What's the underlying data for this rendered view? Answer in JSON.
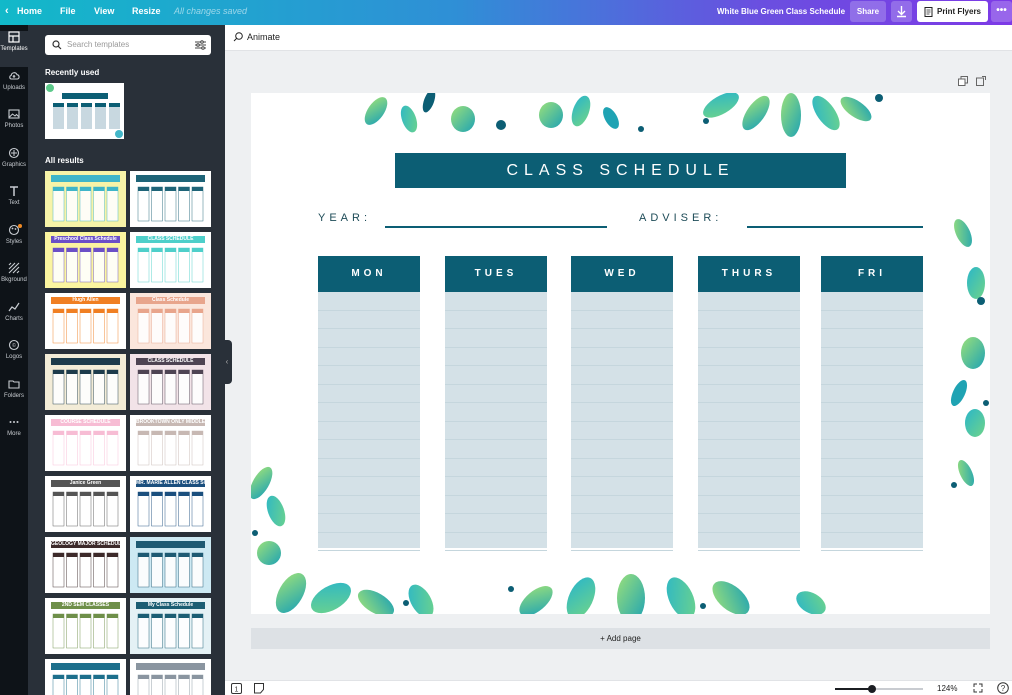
{
  "topbar": {
    "back_icon": "chevron-left-icon",
    "home": "Home",
    "file": "File",
    "view": "View",
    "resize": "Resize",
    "saved_status": "All changes saved",
    "doc_name": "White Blue Green Class Schedule",
    "share": "Share",
    "download_icon": "download-icon",
    "print": "Print Flyers",
    "print_icon": "document-icon",
    "more": "•••"
  },
  "rail": {
    "items": [
      {
        "label": "Templates",
        "icon": "layout-icon",
        "active": true
      },
      {
        "label": "Uploads",
        "icon": "cloud-upload-icon"
      },
      {
        "label": "Photos",
        "icon": "image-icon"
      },
      {
        "label": "Graphics",
        "icon": "shapes-icon"
      },
      {
        "label": "Text",
        "icon": "text-icon"
      },
      {
        "label": "Styles",
        "icon": "palette-icon"
      },
      {
        "label": "Bkground",
        "icon": "pattern-icon"
      },
      {
        "label": "Charts",
        "icon": "chart-icon"
      },
      {
        "label": "Logos",
        "icon": "logo-icon"
      },
      {
        "label": "Folders",
        "icon": "folder-icon"
      },
      {
        "label": "More",
        "icon": "more-icon"
      }
    ]
  },
  "panel": {
    "search_placeholder": "Search templates",
    "recently_used": "Recently used",
    "all_results": "All results",
    "thumbnails": [
      {
        "title": "",
        "color": "#f7f3a8",
        "accent": "#3fb5c9"
      },
      {
        "title": "",
        "color": "#ffffff",
        "accent": "#1e6478"
      },
      {
        "title": "Preschool Class Schedule",
        "color": "#fbf5a0",
        "accent": "#6b4fc7"
      },
      {
        "title": "CLASS SCHEDULE",
        "color": "#ffffff",
        "accent": "#4ecfca"
      },
      {
        "title": "Hugh Allen",
        "color": "#ffffff",
        "accent": "#f07f23"
      },
      {
        "title": "Class Schedule",
        "color": "#fbe6dc",
        "accent": "#e8a58c"
      },
      {
        "title": "",
        "color": "#f3ecd7",
        "accent": "#1d3b4b"
      },
      {
        "title": "CLASS SCHEDULE",
        "color": "#f2e3e8",
        "accent": "#4e4453"
      },
      {
        "title": "COURSE SCHEDULE",
        "color": "#ffffff",
        "accent": "#f7bcd4"
      },
      {
        "title": "BROOKTOWN ONLY MIDDLE SCHOOL",
        "color": "#ffffff",
        "accent": "#c7b8b3"
      },
      {
        "title": "Janice Green",
        "color": "#ffffff",
        "accent": "#555555"
      },
      {
        "title": "MR. MARIE ALLEN CLASS SCHEDULE",
        "color": "#ffffff",
        "accent": "#1b4f7e"
      },
      {
        "title": "GEOLOGY MAJOR SCHEDULE",
        "color": "#ffffff",
        "accent": "#3d2a2a"
      },
      {
        "title": "",
        "color": "#cde9f3",
        "accent": "#1e5a73"
      },
      {
        "title": "2ND SEM CLASSES",
        "color": "#ffffff",
        "accent": "#6e8f49"
      },
      {
        "title": "My Class Schedule",
        "color": "#e4f1f5",
        "accent": "#1b5d73"
      },
      {
        "title": "",
        "color": "#ffffff",
        "accent": "#1d6f8c"
      },
      {
        "title": "",
        "color": "#ffffff",
        "accent": "#8a95a0"
      }
    ]
  },
  "editor": {
    "animate": "Animate",
    "animate_icon": "animate-icon",
    "copy_icon": "duplicate-page-icon",
    "add_icon": "new-page-icon",
    "add_page": "+ Add page",
    "zoom": "124%",
    "zoom_fraction": 0.42,
    "page_number": "1"
  },
  "design": {
    "title": "CLASS SCHEDULE",
    "year_label": "YEAR:",
    "adviser_label": "ADVISER:",
    "days": [
      "MON",
      "TUES",
      "WED",
      "THURS",
      "FRI"
    ],
    "primary_color": "#0c5e74",
    "cell_color": "#d4e1e7"
  }
}
